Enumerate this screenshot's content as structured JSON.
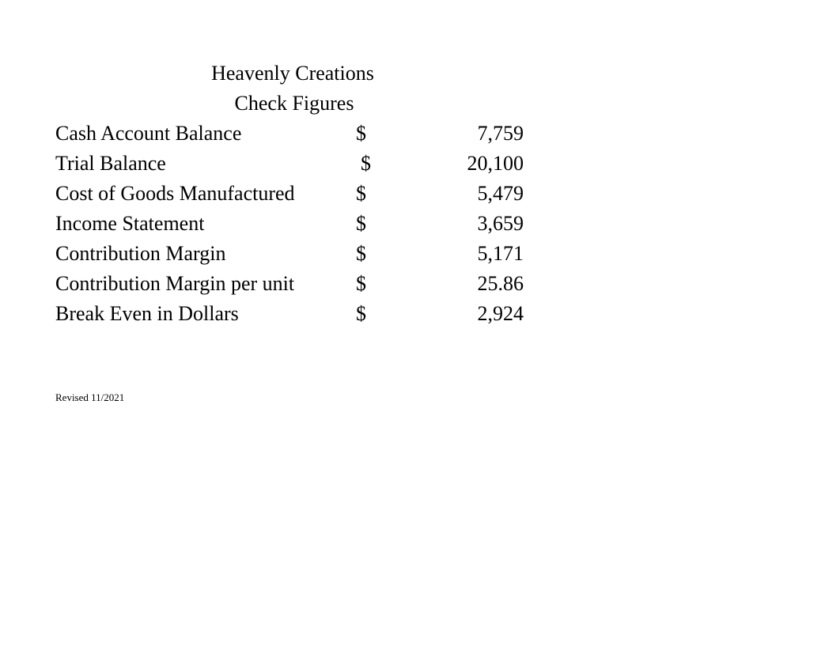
{
  "document": {
    "company_name": "Heavenly Creations",
    "subtitle": "Check Figures",
    "currency_symbol": "$",
    "footer_note": "Revised 11/2021",
    "colors": {
      "page_background": "#ffffff",
      "text": "#000000"
    }
  },
  "figures": [
    {
      "label": "Cash Account Balance",
      "symbol": "$",
      "value": "7,759",
      "wide": false
    },
    {
      "label": "Trial Balance",
      "symbol": "$",
      "value": "20,100",
      "wide": true
    },
    {
      "label": "Cost of Goods Manufactured",
      "symbol": "$",
      "value": "5,479",
      "wide": false
    },
    {
      "label": "Income Statement",
      "symbol": "$",
      "value": "3,659",
      "wide": false
    },
    {
      "label": "Contribution Margin",
      "symbol": "$",
      "value": "5,171",
      "wide": false
    },
    {
      "label": "Contribution Margin per unit",
      "symbol": "$",
      "value": "25.86",
      "wide": false
    },
    {
      "label": "Break Even in Dollars",
      "symbol": "$",
      "value": "2,924",
      "wide": false
    }
  ]
}
